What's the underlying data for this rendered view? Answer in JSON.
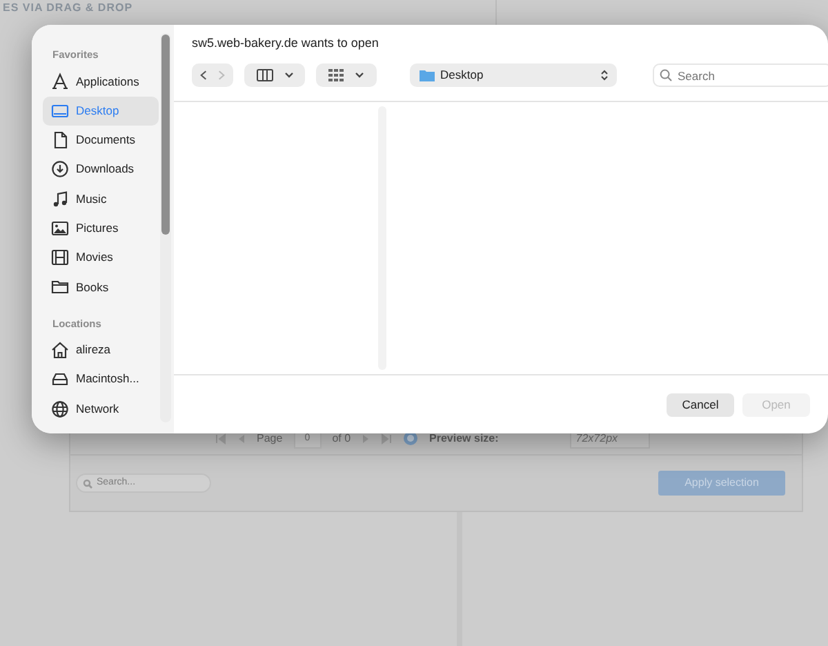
{
  "background_page": {
    "heading": "ES VIA DRAG & DROP",
    "pager": {
      "page_label": "Page",
      "page_value": "0",
      "of_label": "of 0",
      "preview_label": "Preview size:",
      "preview_value": "72x72px"
    },
    "search": {
      "placeholder": "Search..."
    },
    "apply_button": "Apply selection"
  },
  "dialog": {
    "title": "sw5.web-bakery.de wants to open",
    "sidebar": {
      "sections": [
        {
          "heading": "Favorites",
          "items": [
            {
              "label": "Applications",
              "kind": "applications",
              "selected": false
            },
            {
              "label": "Desktop",
              "kind": "desktop",
              "selected": true
            },
            {
              "label": "Documents",
              "kind": "document",
              "selected": false
            },
            {
              "label": "Downloads",
              "kind": "download",
              "selected": false
            },
            {
              "label": "Music",
              "kind": "music",
              "selected": false
            },
            {
              "label": "Pictures",
              "kind": "pictures",
              "selected": false
            },
            {
              "label": "Movies",
              "kind": "movies",
              "selected": false
            },
            {
              "label": "Books",
              "kind": "folder",
              "selected": false
            }
          ]
        },
        {
          "heading": "Locations",
          "items": [
            {
              "label": "alireza",
              "kind": "home",
              "selected": false
            },
            {
              "label": "Macintosh...",
              "kind": "drive",
              "selected": false
            },
            {
              "label": "Network",
              "kind": "network",
              "selected": false
            }
          ]
        }
      ]
    },
    "toolbar": {
      "location": "Desktop",
      "search": {
        "placeholder": "Search"
      }
    },
    "buttons": [
      {
        "label": "Cancel",
        "disabled": false
      },
      {
        "label": "Open",
        "disabled": true
      }
    ]
  }
}
